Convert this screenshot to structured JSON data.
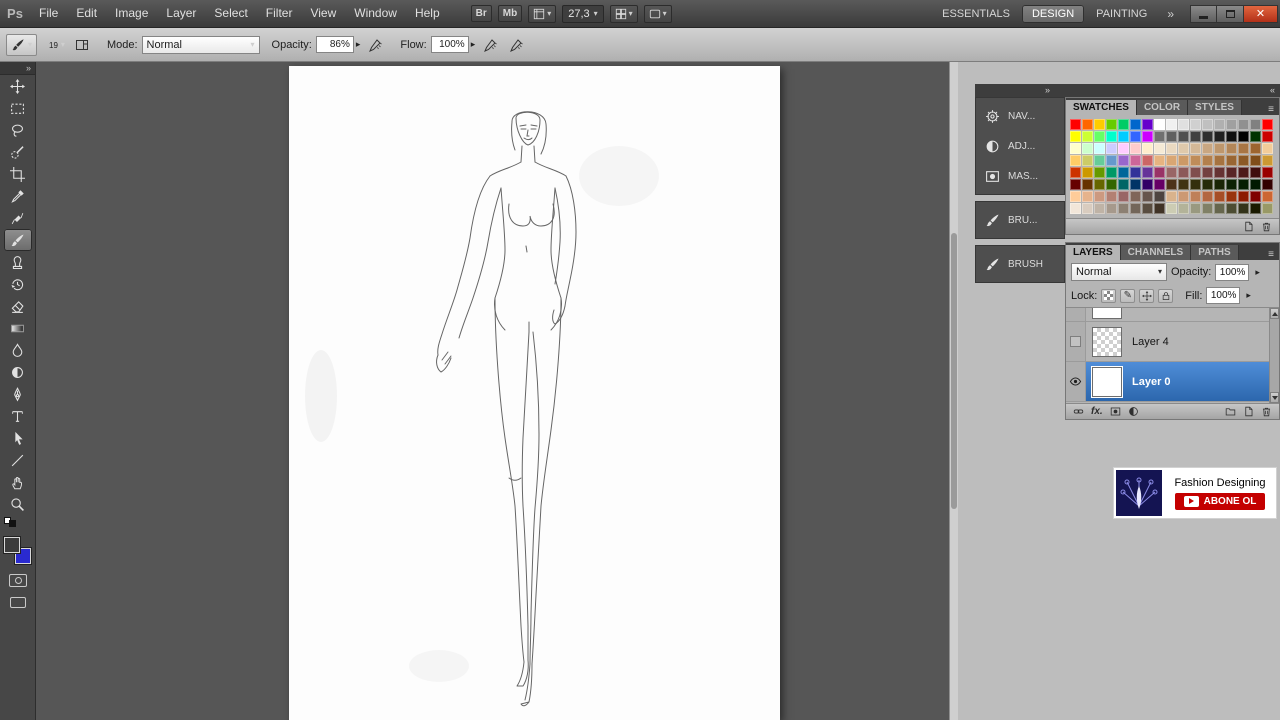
{
  "colors": {
    "selection_blue": "#3474c0",
    "close_red": "#c2431f",
    "subscribe_red": "#c40000",
    "foreground": "#3c3c3c",
    "background": "#2a2ad0"
  },
  "icons": {
    "close": "✕",
    "caret_down": "▾",
    "caret_right": "▸",
    "panel_menu": "≡",
    "chevron_expand": "»",
    "chevron_collapse": "«",
    "pencil": "✎"
  },
  "topbar": {
    "logo": "Ps",
    "menus": [
      "File",
      "Edit",
      "Image",
      "Layer",
      "Select",
      "Filter",
      "View",
      "Window",
      "Help"
    ],
    "bridge": "Br",
    "mini_bridge": "Mb",
    "zoom_value": "27,3",
    "workspaces": [
      "ESSENTIALS",
      "DESIGN",
      "PAINTING"
    ],
    "active_workspace": "DESIGN",
    "overflow": "»"
  },
  "options_bar": {
    "brush_size": "19",
    "mode_label": "Mode:",
    "mode_value": "Normal",
    "opacity_label": "Opacity:",
    "opacity_value": "86%",
    "flow_label": "Flow:",
    "flow_value": "100%"
  },
  "tools": [
    "move",
    "rectangular-marquee",
    "lasso",
    "quick-selection",
    "crop",
    "eyedropper",
    "spot-healing-brush",
    "brush",
    "clone-stamp",
    "history-brush",
    "eraser",
    "gradient",
    "blur",
    "dodge",
    "pen",
    "type",
    "path-selection",
    "line",
    "hand",
    "zoom"
  ],
  "active_tool": "brush",
  "dock": {
    "items": [
      {
        "label": "NAV...",
        "icon": "navigator-panel-icon"
      },
      {
        "label": "ADJ...",
        "icon": "adjustments-panel-icon"
      },
      {
        "label": "MAS...",
        "icon": "masks-panel-icon"
      },
      {
        "label": "BRU...",
        "icon": "brush-presets-panel-icon"
      },
      {
        "label": "BRUSH",
        "icon": "brush-panel-icon"
      }
    ]
  },
  "swatches_panel": {
    "tabs": [
      "SWATCHES",
      "COLOR",
      "STYLES"
    ],
    "active_tab": "SWATCHES",
    "palette": [
      [
        "#ff0000",
        "#ff6600",
        "#ffcc00",
        "#66cc00",
        "#00cc66",
        "#0066cc",
        "#6600cc",
        "#ffffff",
        "#f0f0f0",
        "#e0e0e0",
        "#d0d0d0",
        "#c0c0c0",
        "#b0b0b0",
        "#a0a0a0",
        "#909090",
        "#808080",
        "#ff0000"
      ],
      [
        "#ffff00",
        "#ccff33",
        "#66ff66",
        "#00ffcc",
        "#00ccff",
        "#3366ff",
        "#cc00ff",
        "#707070",
        "#606060",
        "#505050",
        "#404040",
        "#303030",
        "#202020",
        "#101010",
        "#000000",
        "#003300",
        "#cc0000"
      ],
      [
        "#ffffcc",
        "#ccffcc",
        "#ccffff",
        "#ccccff",
        "#ffccff",
        "#ffcccc",
        "#ffeecc",
        "#f5ead5",
        "#ead9c0",
        "#dfc9ab",
        "#d4b897",
        "#c9a782",
        "#be976d",
        "#b38658",
        "#a87544",
        "#9d652f",
        "#f2cc99"
      ],
      [
        "#ffcc66",
        "#cccc66",
        "#66cc99",
        "#6699cc",
        "#9966cc",
        "#cc6699",
        "#cc6666",
        "#e6b380",
        "#d9a673",
        "#cc9966",
        "#bf8c59",
        "#b3804d",
        "#a67340",
        "#996633",
        "#8c5926",
        "#804d19",
        "#cc9933"
      ],
      [
        "#cc3300",
        "#cc9900",
        "#669900",
        "#009966",
        "#006699",
        "#333399",
        "#663399",
        "#993366",
        "#996666",
        "#8c5959",
        "#804d4d",
        "#734040",
        "#663333",
        "#592626",
        "#4d1a1a",
        "#400d0d",
        "#990000"
      ],
      [
        "#660000",
        "#663300",
        "#666600",
        "#336600",
        "#006666",
        "#003366",
        "#330066",
        "#660066",
        "#4d3319",
        "#403313",
        "#332f0d",
        "#262b08",
        "#1a2606",
        "#0d2204",
        "#061d02",
        "#001900",
        "#330000"
      ],
      [
        "#ffcc99",
        "#e6b38c",
        "#cc9980",
        "#b38073",
        "#996666",
        "#806659",
        "#66554d",
        "#4d4440",
        "#d9b38c",
        "#cc9973",
        "#bf8059",
        "#b36640",
        "#a64d26",
        "#99330d",
        "#8c1a00",
        "#800000",
        "#cc6633"
      ],
      [
        "#f2e6d9",
        "#d9ccbf",
        "#bfb3a6",
        "#a6998c",
        "#8c8073",
        "#736659",
        "#594d40",
        "#403326",
        "#ccccb3",
        "#b3b399",
        "#999980",
        "#808066",
        "#66664d",
        "#4d4d33",
        "#33331a",
        "#1a1a00",
        "#999966"
      ]
    ]
  },
  "layers_panel": {
    "tabs": [
      "LAYERS",
      "CHANNELS",
      "PATHS"
    ],
    "active_tab": "LAYERS",
    "blend_mode": "Normal",
    "opacity_label": "Opacity:",
    "opacity_value": "100%",
    "lock_label": "Lock:",
    "fill_label": "Fill:",
    "fill_value": "100%",
    "fx_label": "fx.",
    "layers": [
      {
        "name": "Layer 4",
        "visible": false,
        "selected": false
      },
      {
        "name": "Layer 0",
        "visible": true,
        "selected": true
      }
    ]
  },
  "overlay_card": {
    "title": "Fashion Designing",
    "subscribe_label": "ABONE OL"
  }
}
